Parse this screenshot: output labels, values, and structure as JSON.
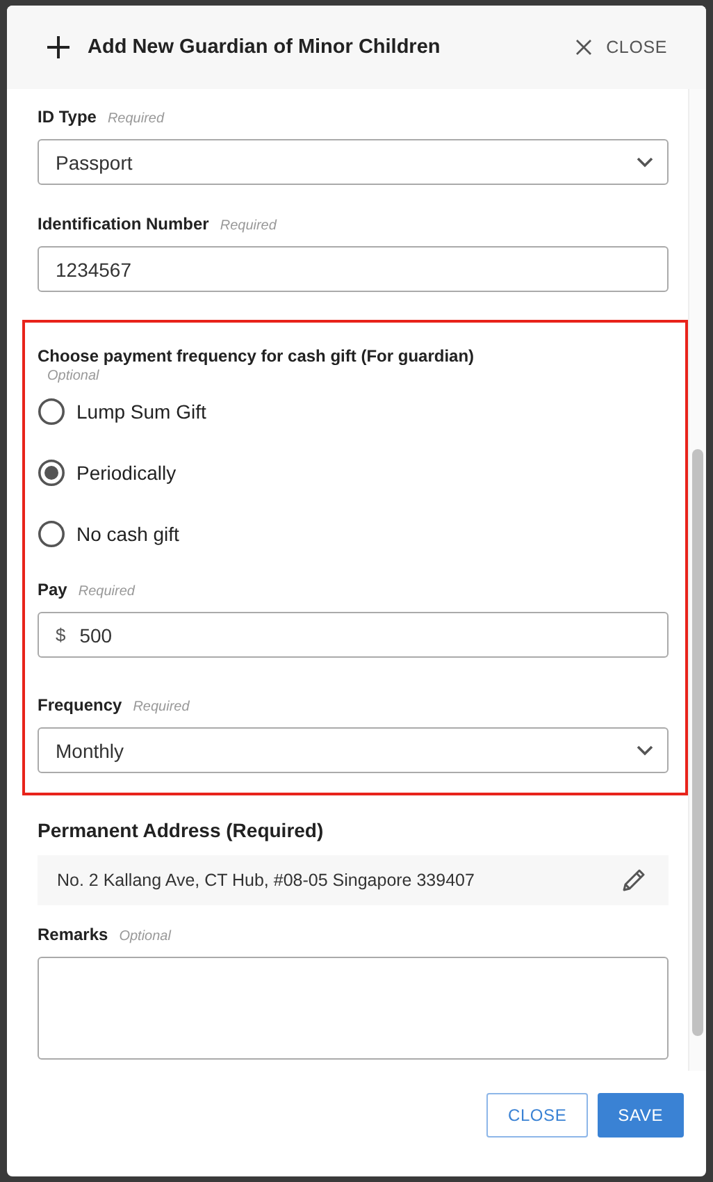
{
  "dialog": {
    "title": "Add New Guardian of Minor Children",
    "close_label": "CLOSE"
  },
  "fields": [
    {
      "kind": "select",
      "label": "ID Type",
      "hint": "Required",
      "value": "Passport"
    },
    {
      "kind": "text",
      "label": "Identification Number",
      "hint": "Required",
      "value": "1234567"
    }
  ],
  "highlight_section": {
    "question": "Choose payment frequency for cash gift (For guardian)",
    "hint": "Optional",
    "options": [
      {
        "label": "Lump Sum Gift",
        "selected": false
      },
      {
        "label": "Periodically",
        "selected": true
      },
      {
        "label": "No cash gift",
        "selected": false
      }
    ],
    "fields": [
      {
        "kind": "currency",
        "label": "Pay",
        "hint": "Required",
        "prefix": "$",
        "value": "500"
      },
      {
        "kind": "select",
        "label": "Frequency",
        "hint": "Required",
        "value": "Monthly"
      }
    ]
  },
  "address": {
    "label": "Permanent Address (Required)",
    "value": "No. 2 Kallang Ave, CT Hub, #08-05 Singapore 339407"
  },
  "remarks": {
    "label": "Remarks",
    "hint": "Optional"
  },
  "buttons": [
    {
      "label": "CLOSE",
      "kind": "secondary"
    },
    {
      "label": "SAVE",
      "kind": "primary"
    }
  ]
}
